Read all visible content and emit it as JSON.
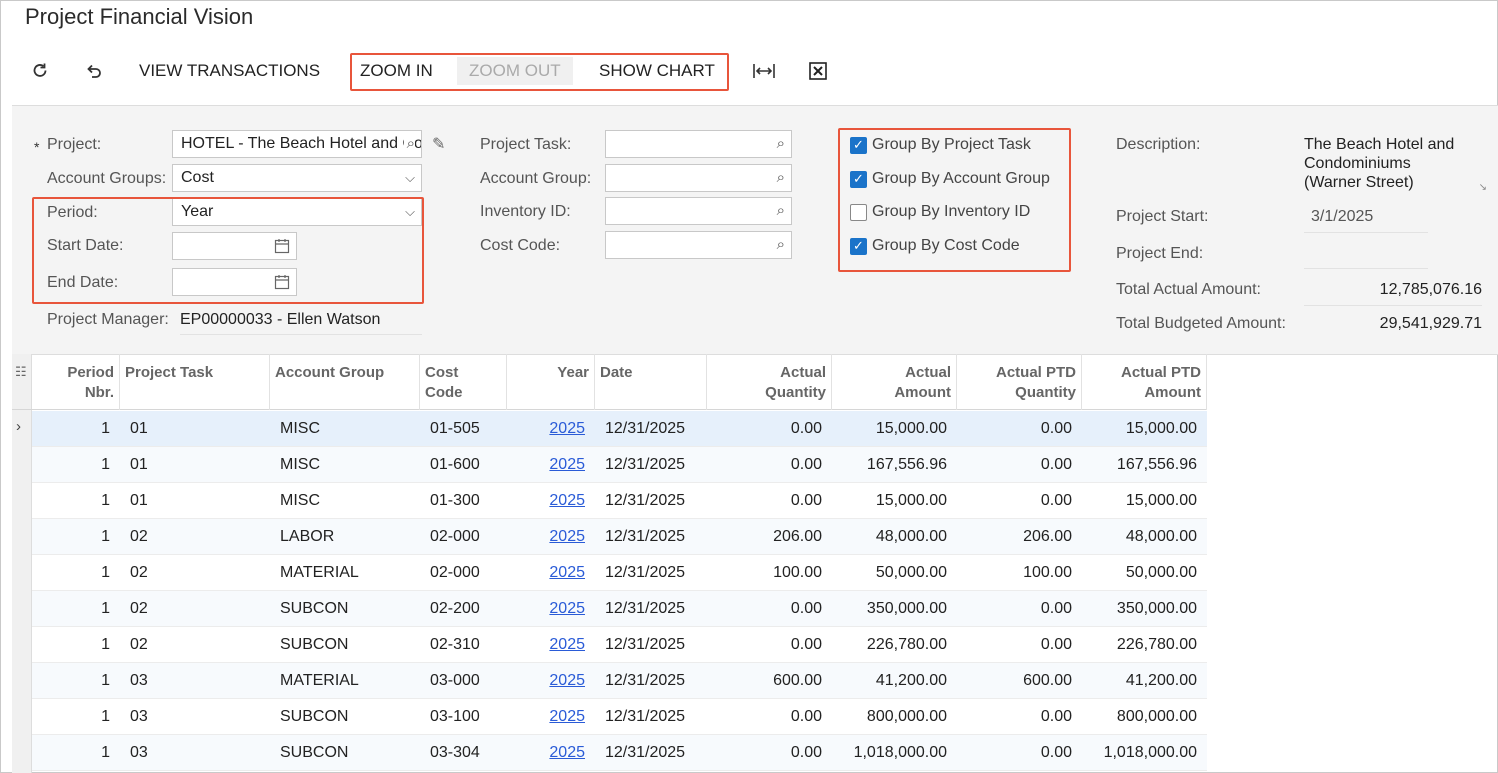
{
  "page": {
    "title": "Project Financial Vision"
  },
  "toolbar": {
    "view_transactions": "VIEW TRANSACTIONS",
    "zoom_in": "ZOOM IN",
    "zoom_out": "ZOOM OUT",
    "show_chart": "SHOW CHART"
  },
  "form": {
    "project": {
      "label": "Project:",
      "value": "HOTEL - The Beach Hotel and Condominiums"
    },
    "account_groups": {
      "label": "Account Groups:",
      "value": "Cost"
    },
    "period": {
      "label": "Period:",
      "value": "Year"
    },
    "start_date": {
      "label": "Start Date:",
      "value": ""
    },
    "end_date": {
      "label": "End Date:",
      "value": ""
    },
    "project_manager": {
      "label": "Project Manager:",
      "value": "EP00000033 - Ellen Watson"
    },
    "project_task": {
      "label": "Project Task:",
      "value": ""
    },
    "account_group": {
      "label": "Account Group:",
      "value": ""
    },
    "inventory_id": {
      "label": "Inventory ID:",
      "value": ""
    },
    "cost_code": {
      "label": "Cost Code:",
      "value": ""
    },
    "checks": [
      {
        "label": "Group By Project Task",
        "checked": true
      },
      {
        "label": "Group By Account Group",
        "checked": true
      },
      {
        "label": "Group By Inventory ID",
        "checked": false
      },
      {
        "label": "Group By Cost Code",
        "checked": true
      }
    ],
    "description": {
      "label": "Description:",
      "line1": "The Beach Hotel and",
      "line2": "Condominiums",
      "line3": "(Warner Street)"
    },
    "project_start": {
      "label": "Project Start:",
      "value": "3/1/2025"
    },
    "project_end": {
      "label": "Project End:",
      "value": ""
    },
    "total_actual": {
      "label": "Total Actual Amount:",
      "value": "12,785,076.16"
    },
    "total_budgeted": {
      "label": "Total Budgeted Amount:",
      "value": "29,541,929.71"
    }
  },
  "grid": {
    "headers": {
      "period_nbr_1": "Period",
      "period_nbr_2": "Nbr.",
      "project_task": "Project Task",
      "account_group": "Account Group",
      "cost_code_1": "Cost",
      "cost_code_2": "Code",
      "year": "Year",
      "date": "Date",
      "actual_qty_1": "Actual",
      "actual_qty_2": "Quantity",
      "actual_amt_1": "Actual",
      "actual_amt_2": "Amount",
      "ptd_qty_1": "Actual PTD",
      "ptd_qty_2": "Quantity",
      "ptd_amt_1": "Actual PTD",
      "ptd_amt_2": "Amount"
    },
    "rows": [
      {
        "period": "1",
        "task": "01",
        "group": "MISC",
        "code": "01-505",
        "year": "2025",
        "date": "12/31/2025",
        "qty": "0.00",
        "amt": "15,000.00",
        "ptd_qty": "0.00",
        "ptd_amt": "15,000.00"
      },
      {
        "period": "1",
        "task": "01",
        "group": "MISC",
        "code": "01-600",
        "year": "2025",
        "date": "12/31/2025",
        "qty": "0.00",
        "amt": "167,556.96",
        "ptd_qty": "0.00",
        "ptd_amt": "167,556.96"
      },
      {
        "period": "1",
        "task": "01",
        "group": "MISC",
        "code": "01-300",
        "year": "2025",
        "date": "12/31/2025",
        "qty": "0.00",
        "amt": "15,000.00",
        "ptd_qty": "0.00",
        "ptd_amt": "15,000.00"
      },
      {
        "period": "1",
        "task": "02",
        "group": "LABOR",
        "code": "02-000",
        "year": "2025",
        "date": "12/31/2025",
        "qty": "206.00",
        "amt": "48,000.00",
        "ptd_qty": "206.00",
        "ptd_amt": "48,000.00"
      },
      {
        "period": "1",
        "task": "02",
        "group": "MATERIAL",
        "code": "02-000",
        "year": "2025",
        "date": "12/31/2025",
        "qty": "100.00",
        "amt": "50,000.00",
        "ptd_qty": "100.00",
        "ptd_amt": "50,000.00"
      },
      {
        "period": "1",
        "task": "02",
        "group": "SUBCON",
        "code": "02-200",
        "year": "2025",
        "date": "12/31/2025",
        "qty": "0.00",
        "amt": "350,000.00",
        "ptd_qty": "0.00",
        "ptd_amt": "350,000.00"
      },
      {
        "period": "1",
        "task": "02",
        "group": "SUBCON",
        "code": "02-310",
        "year": "2025",
        "date": "12/31/2025",
        "qty": "0.00",
        "amt": "226,780.00",
        "ptd_qty": "0.00",
        "ptd_amt": "226,780.00"
      },
      {
        "period": "1",
        "task": "03",
        "group": "MATERIAL",
        "code": "03-000",
        "year": "2025",
        "date": "12/31/2025",
        "qty": "600.00",
        "amt": "41,200.00",
        "ptd_qty": "600.00",
        "ptd_amt": "41,200.00"
      },
      {
        "period": "1",
        "task": "03",
        "group": "SUBCON",
        "code": "03-100",
        "year": "2025",
        "date": "12/31/2025",
        "qty": "0.00",
        "amt": "800,000.00",
        "ptd_qty": "0.00",
        "ptd_amt": "800,000.00"
      },
      {
        "period": "1",
        "task": "03",
        "group": "SUBCON",
        "code": "03-304",
        "year": "2025",
        "date": "12/31/2025",
        "qty": "0.00",
        "amt": "1,018,000.00",
        "ptd_qty": "0.00",
        "ptd_amt": "1,018,000.00"
      }
    ]
  }
}
